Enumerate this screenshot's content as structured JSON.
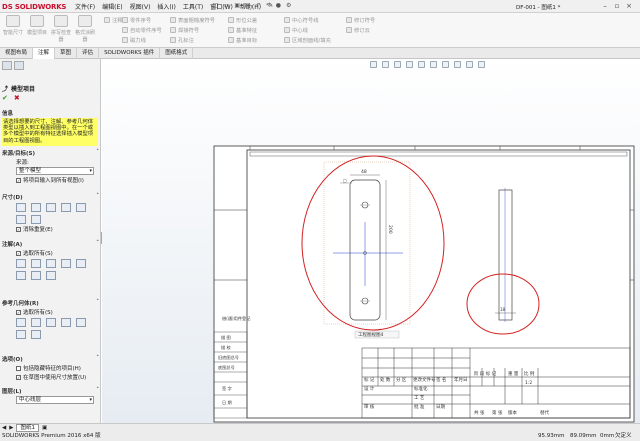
{
  "app": {
    "logo_ds": "DS",
    "logo_name": "SOLIDWORKS",
    "document_title": "DF-001 - 图纸1 *",
    "menus": [
      "文件(F)",
      "编辑(E)",
      "视图(V)",
      "插入(I)",
      "工具(T)",
      "窗口(W)",
      "帮助(H)"
    ]
  },
  "command_manager": {
    "big_buttons": [
      "智能尺寸",
      "模型项目",
      "拼写检查器",
      "格式涂刷器"
    ],
    "column1": [
      "注释",
      "零件序号",
      "自动零件序号",
      "磁力线"
    ],
    "column2": [
      "表面粗糙度符号",
      "焊接符号",
      "形位公差",
      "孔标注"
    ],
    "column3": [
      "基准特征",
      "基准目标",
      "多转折引线"
    ],
    "column4": [
      "中心符号线",
      "中心线",
      "区域剖面线/填充"
    ],
    "column5": [
      "修订符号",
      "修订云"
    ]
  },
  "tabs": [
    "视图布局",
    "注解",
    "草图",
    "评估",
    "SOLIDWORKS 插件",
    "图纸格式"
  ],
  "active_tab_index": 1,
  "panel": {
    "title": "模型项目",
    "ok": "✔",
    "cancel": "✖",
    "message_header": "信息",
    "message": "请选择想要的尺寸、注解、参考几何体类型以插入到工程图视图中。在一个或多个模型中的所有特征选择插入模型项目的工程图视图。",
    "source_header": "来源/目标(S)",
    "source_label": "来源:",
    "source_value": "整个模型",
    "source_check": "将项目输入到所有视图(I)",
    "dim_header": "尺寸(D)",
    "dim_check": "消除重复(E)",
    "ann_header": "注解(A)",
    "ann_check": "选取所有(S)",
    "ref_header": "参考几何体(R)",
    "ref_check": "选取所有(S)",
    "opt_header": "选项(O)",
    "opt_check1": "包括隐藏特征的项目(H)",
    "opt_check2": "在草图中使用尺寸放置(U)",
    "layer_header": "图层(L)",
    "layer_value": "中心线层"
  },
  "drawing": {
    "view_label": "工程图视图4",
    "dim_width": "48",
    "dim_height": "200",
    "dim_small": "18",
    "row_labels": [
      "借(通)用件登记",
      "描 图",
      "描 校",
      "旧底图总号",
      "底图总号",
      "签 字",
      "日 期"
    ],
    "title_block": [
      "标 记",
      "处 数",
      "分 区",
      "更改文件号",
      "签 名",
      "年月日",
      "设 计",
      "标准化",
      "审 核",
      "工 艺",
      "批 准",
      "日期",
      "阶 段 标 记",
      "重 量",
      "比 例",
      "1:2",
      "共 张",
      "第 张",
      "版本",
      "替代"
    ]
  },
  "status": {
    "sheet_tab": "图纸1",
    "product": "SOLIDWORKS Premium 2016 x64 版",
    "x": "95.93mm",
    "y": "89.09mm",
    "z": "0mm",
    "state": "欠定义"
  },
  "colors": {
    "accent_red": "#c8102e",
    "annotation_red": "#d42020",
    "centerline_blue": "#2040d0",
    "info_yellow": "#ffff66"
  }
}
